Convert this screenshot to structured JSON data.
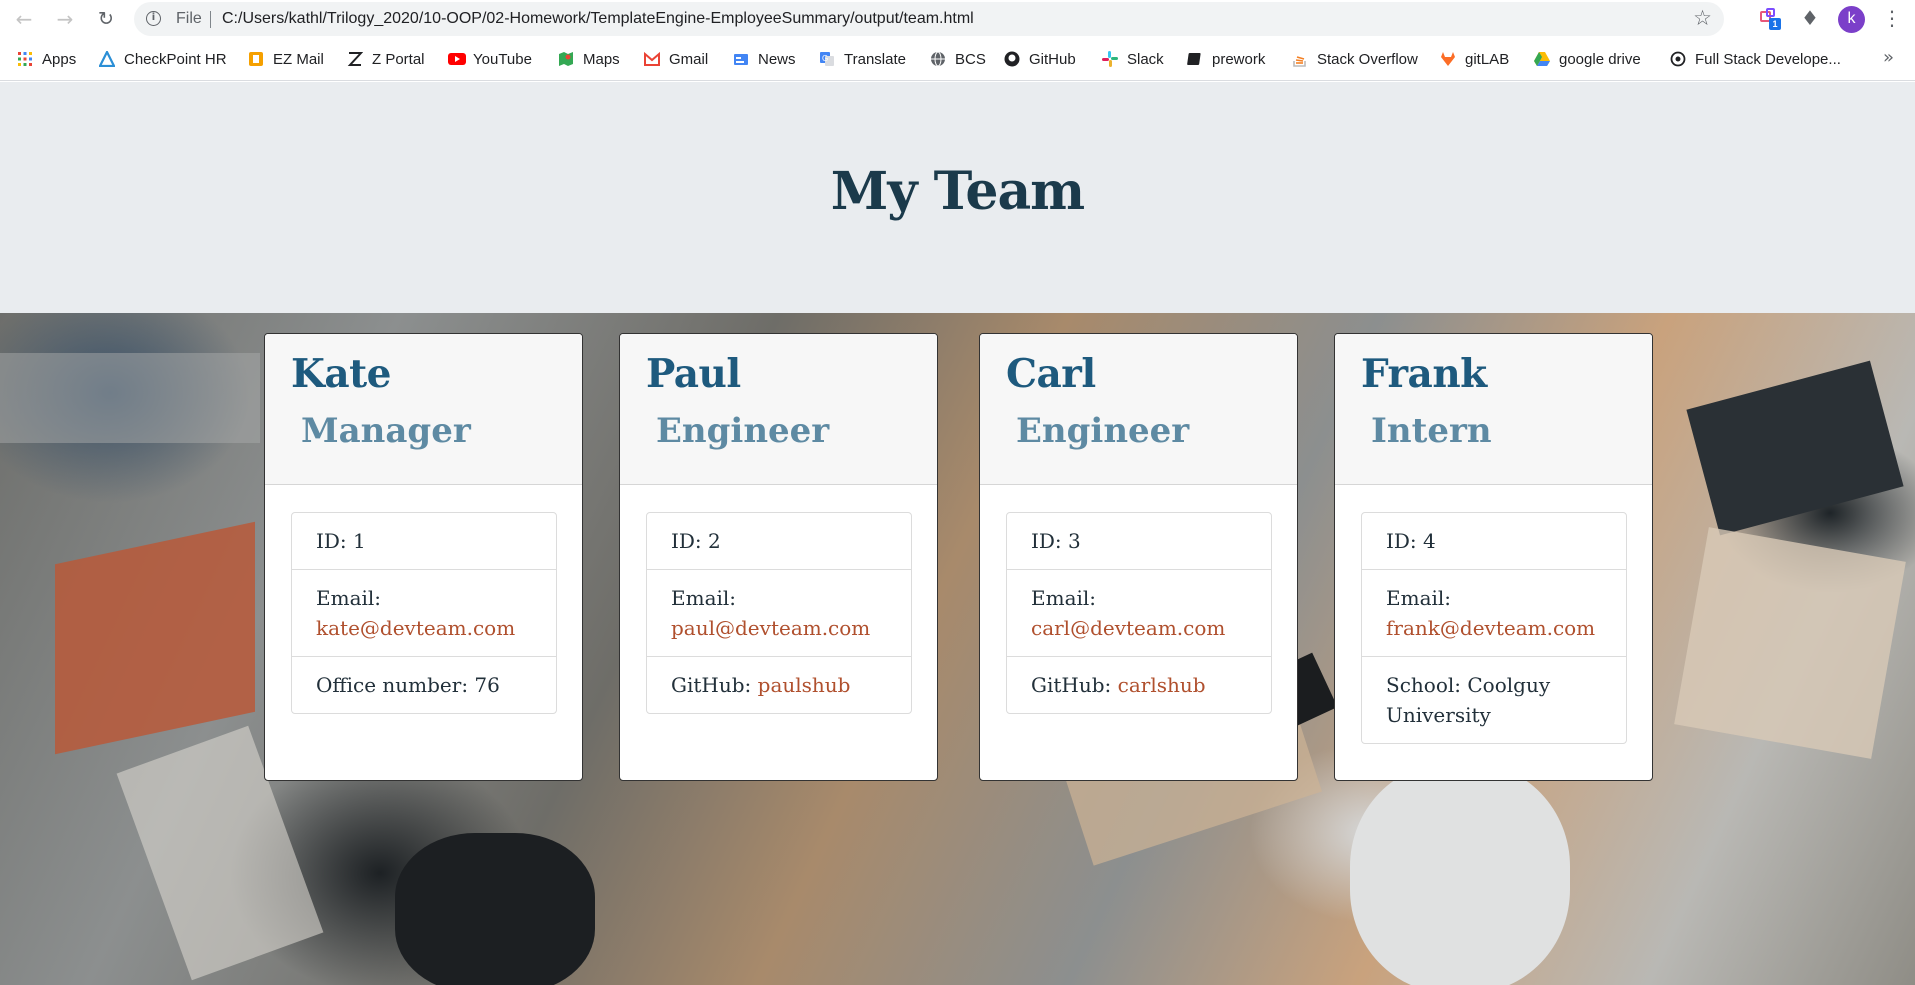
{
  "browser": {
    "file_label": "File",
    "url": "C:/Users/kathl/Trilogy_2020/10-OOP/02-Homework/TemplateEngine-EmployeeSummary/output/team.html",
    "profile_initial": "k",
    "extension_badge": "1",
    "bookmarks": [
      {
        "label": "Apps",
        "icon": "apps-grid-icon"
      },
      {
        "label": "CheckPoint HR",
        "icon": "checkpoint-icon"
      },
      {
        "label": "EZ Mail",
        "icon": "ezmail-icon"
      },
      {
        "label": "Z Portal",
        "icon": "zportal-icon"
      },
      {
        "label": "YouTube",
        "icon": "youtube-icon"
      },
      {
        "label": "Maps",
        "icon": "maps-icon"
      },
      {
        "label": "Gmail",
        "icon": "gmail-icon"
      },
      {
        "label": "News",
        "icon": "news-icon"
      },
      {
        "label": "Translate",
        "icon": "translate-icon"
      },
      {
        "label": "BCS",
        "icon": "globe-icon"
      },
      {
        "label": "GitHub",
        "icon": "github-icon"
      },
      {
        "label": "Slack",
        "icon": "slack-icon"
      },
      {
        "label": "prework",
        "icon": "book-icon"
      },
      {
        "label": "Stack Overflow",
        "icon": "stackoverflow-icon"
      },
      {
        "label": "gitLAB",
        "icon": "gitlab-icon"
      },
      {
        "label": "google drive",
        "icon": "google-drive-icon"
      },
      {
        "label": "Full Stack Develope...",
        "icon": "fullstack-icon"
      }
    ]
  },
  "page": {
    "title": "My Team",
    "colors": {
      "name": "#1e5a7e",
      "role": "#5e8aa3",
      "link": "#b0502e",
      "title": "#1b3a4b"
    },
    "members": [
      {
        "name": "Kate",
        "role": "Manager",
        "id_text": "ID: 1",
        "email_label": "Email:",
        "email": "kate@devteam.com",
        "extra_label": "Office number: 76",
        "extra_value": ""
      },
      {
        "name": "Paul",
        "role": "Engineer",
        "id_text": "ID: 2",
        "email_label": "Email:",
        "email": "paul@devteam.com",
        "extra_label": "GitHub: ",
        "extra_value": "paulshub"
      },
      {
        "name": "Carl",
        "role": "Engineer",
        "id_text": "ID: 3",
        "email_label": "Email:",
        "email": "carl@devteam.com",
        "extra_label": "GitHub: ",
        "extra_value": "carlshub"
      },
      {
        "name": "Frank",
        "role": "Intern",
        "id_text": "ID: 4",
        "email_label": "Email:",
        "email": "frank@devteam.com",
        "extra_label": "School: Coolguy University",
        "extra_value": ""
      }
    ]
  }
}
